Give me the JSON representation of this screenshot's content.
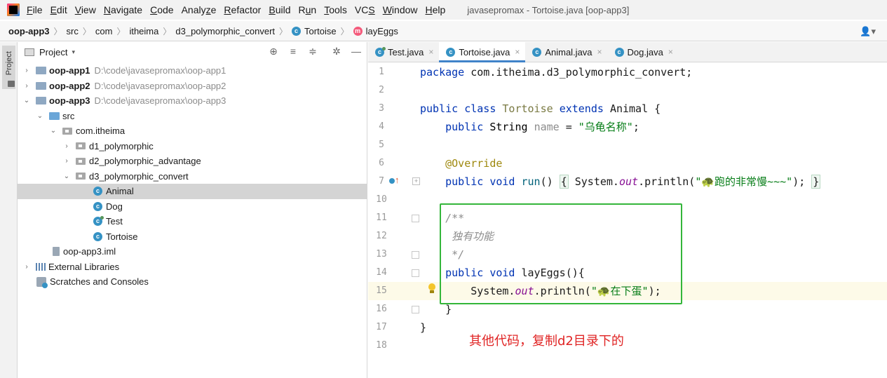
{
  "menubar": {
    "items": [
      {
        "u": "F",
        "rest": "ile"
      },
      {
        "u": "E",
        "rest": "dit"
      },
      {
        "u": "V",
        "rest": "iew"
      },
      {
        "u": "N",
        "rest": "avigate"
      },
      {
        "u": "C",
        "rest": "ode"
      },
      {
        "pre": "Analy",
        "u": "z",
        "rest": "e"
      },
      {
        "u": "R",
        "rest": "efactor"
      },
      {
        "u": "B",
        "rest": "uild"
      },
      {
        "pre": "R",
        "u": "u",
        "rest": "n"
      },
      {
        "u": "T",
        "rest": "ools"
      },
      {
        "pre": "VC",
        "u": "S",
        "rest": ""
      },
      {
        "u": "W",
        "rest": "indow"
      },
      {
        "u": "H",
        "rest": "elp"
      }
    ],
    "window_title": "javasepromax - Tortoise.java [oop-app3]"
  },
  "breadcrumb": {
    "items": [
      "oop-app3",
      "src",
      "com",
      "itheima",
      "d3_polymorphic_convert",
      "Tortoise",
      "layEggs"
    ],
    "class_badge": "c",
    "method_badge": "m"
  },
  "user_icon": "user-icon",
  "tool_stripe": {
    "project_label": "Project"
  },
  "project_panel": {
    "title": "Project",
    "dropdown_icon": "▾",
    "tools": [
      "⊕",
      "≡",
      "≑",
      "✲",
      "—"
    ],
    "tree": [
      {
        "arrow": "›",
        "name": "oop-app1",
        "path": "D:\\code\\javasepromax\\oop-app1"
      },
      {
        "arrow": "›",
        "name": "oop-app2",
        "path": "D:\\code\\javasepromax\\oop-app2"
      },
      {
        "arrow": "⌄",
        "name": "oop-app3",
        "path": "D:\\code\\javasepromax\\oop-app3"
      },
      {
        "arrow": "⌄",
        "name": "src"
      },
      {
        "arrow": "⌄",
        "name": "com.itheima"
      },
      {
        "arrow": "›",
        "name": "d1_polymorphic"
      },
      {
        "arrow": "›",
        "name": "d2_polymorphic_advantage"
      },
      {
        "arrow": "⌄",
        "name": "d3_polymorphic_convert"
      },
      {
        "name": "Animal",
        "badge": "c"
      },
      {
        "name": "Dog",
        "badge": "c"
      },
      {
        "name": "Test",
        "badge": "c"
      },
      {
        "name": "Tortoise",
        "badge": "c"
      },
      {
        "name": "oop-app3.iml"
      },
      {
        "arrow": "›",
        "name": "External Libraries"
      },
      {
        "name": "Scratches and Consoles"
      }
    ]
  },
  "editor_tabs": [
    {
      "label": "Test.java",
      "badge": "c",
      "close": "×"
    },
    {
      "label": "Tortoise.java",
      "badge": "c",
      "close": "×"
    },
    {
      "label": "Animal.java",
      "badge": "c",
      "close": "×"
    },
    {
      "label": "Dog.java",
      "badge": "c",
      "close": "×"
    }
  ],
  "code": {
    "line_numbers": [
      "1",
      "2",
      "3",
      "4",
      "5",
      "6",
      "7",
      "10",
      "11",
      "12",
      "13",
      "14",
      "15",
      "16",
      "17",
      "18"
    ],
    "l1_kw": "package",
    "l1_rest": " com.itheima.d3_polymorphic_convert;",
    "l3_kw1": "public",
    "l3_kw2": "class",
    "l3_cls": "Tortoise",
    "l3_kw3": "extends",
    "l3_rest": "Animal {",
    "l4_kw": "public",
    "l4_type": "String",
    "l4_field": "name",
    "l4_eq": " = ",
    "l4_str": "\"乌龟名称\"",
    "l4_end": ";",
    "l6_anno": "@Override",
    "l7_kw1": "public",
    "l7_kw2": "void",
    "l7_fn": "run",
    "l7_paren": "() ",
    "l7_open": "{",
    "l7_sys": " System.",
    "l7_out": "out",
    "l7_call": ".println(",
    "l7_str": "\"🐢跑的非常慢~~~\"",
    "l7_end": "); ",
    "l7_close": "}",
    "l11": "/**",
    "l12": " 独有功能",
    "l13": " */",
    "l14_kw1": "public",
    "l14_kw2": "void",
    "l14_rest": "layEggs(){",
    "l15_sys": "System.",
    "l15_out": "out",
    "l15_call": ".println(",
    "l15_str": "\"🐢在下蛋\"",
    "l15_end": ");",
    "l16": "}",
    "l17": "}"
  },
  "annotation_note": "其他代码，复制d2目录下的",
  "colors": {
    "keyword": "#0033b3",
    "string": "#067d17",
    "annotation": "#9e880d",
    "comment": "#8c8c8c",
    "highlight_box": "#34b63a",
    "note_text": "#e02424",
    "active_tab_underline": "#4083c9"
  }
}
